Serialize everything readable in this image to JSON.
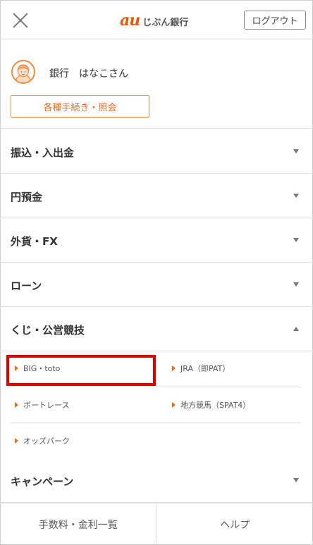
{
  "header": {
    "logo_mark": "au",
    "logo_text": "じぶん銀行",
    "logout_label": "ログアウト",
    "close_icon": "close-icon",
    "brand_color": "#eb5505"
  },
  "profile": {
    "avatar_icon": "user-avatar-icon",
    "user_name": "銀行　はなこさん",
    "procedures_label": "各種手続き・照会"
  },
  "menu": {
    "items": [
      {
        "label": "振込・入出金",
        "expanded": false
      },
      {
        "label": "円預金",
        "expanded": false
      },
      {
        "label": "外貨・FX",
        "expanded": false
      },
      {
        "label": "ローン",
        "expanded": false
      },
      {
        "label": "くじ・公営競技",
        "expanded": true
      },
      {
        "label": "キャンペーン",
        "expanded": false
      }
    ]
  },
  "lottery_submenu": {
    "items": [
      {
        "label": "BIG・toto",
        "highlighted": true
      },
      {
        "label": "JRA（即PAT）",
        "highlighted": false
      },
      {
        "label": "ボートレース",
        "highlighted": false
      },
      {
        "label": "地方競馬（SPAT4）",
        "highlighted": false
      },
      {
        "label": "オッズパーク",
        "highlighted": false
      }
    ],
    "highlight_color": "#e00000"
  },
  "footer": {
    "fees_label": "手数料・金利一覧",
    "help_label": "ヘルプ"
  }
}
